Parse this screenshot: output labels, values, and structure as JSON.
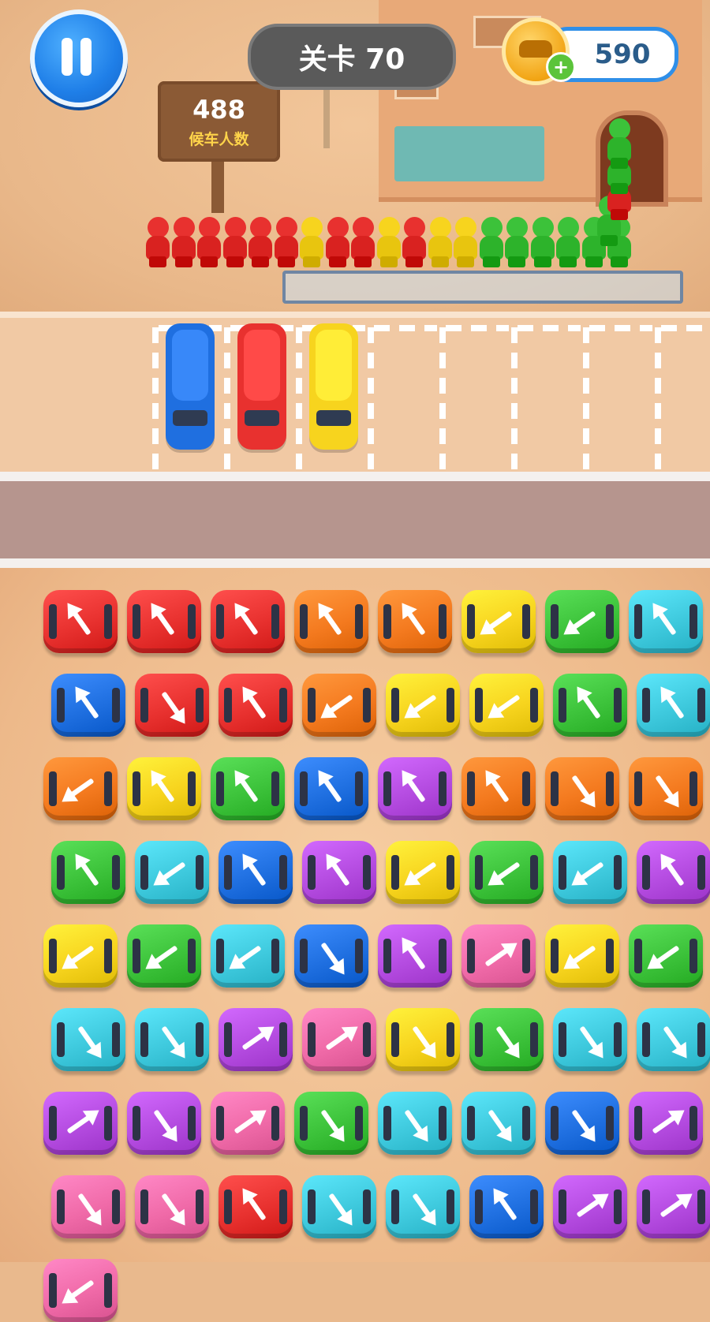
{
  "hud": {
    "level_label": "关卡 70",
    "coins": "590",
    "plus_label": "+",
    "pause_icon": "pause-icon",
    "coin_icon": "car-coin-icon"
  },
  "waiting_sign": {
    "count": "488",
    "label": "候车人数"
  },
  "queue": {
    "order": [
      "red",
      "red",
      "red",
      "red",
      "red",
      "red",
      "yellow",
      "red",
      "red",
      "yellow",
      "red",
      "yellow",
      "yellow",
      "green",
      "green",
      "green",
      "green",
      "green",
      "green",
      "green",
      "red",
      "green",
      "green"
    ]
  },
  "colors": {
    "red": "#e8312f",
    "orange": "#f47a1f",
    "yellow": "#f7d41e",
    "green": "#3cc23a",
    "cyan": "#3ec9dd",
    "blue": "#1f6fe0",
    "purple": "#b44be0",
    "pink": "#f06aa8"
  },
  "parked_cars": [
    {
      "color": "blue",
      "passengers": "blue"
    },
    {
      "color": "red",
      "passengers": "red"
    },
    {
      "color": "yellow",
      "passengers": "yellow"
    }
  ],
  "parking_spots": 8,
  "puzzle_cars": [
    {
      "color": "red",
      "dir": "up"
    },
    {
      "color": "red",
      "dir": "up"
    },
    {
      "color": "red",
      "dir": "up"
    },
    {
      "color": "orange",
      "dir": "up"
    },
    {
      "color": "orange",
      "dir": "up"
    },
    {
      "color": "yellow",
      "dir": "left"
    },
    {
      "color": "green",
      "dir": "left"
    },
    {
      "color": "cyan",
      "dir": "up"
    },
    {
      "color": "blue",
      "dir": "up"
    },
    {
      "color": "red",
      "dir": "down"
    },
    {
      "color": "red",
      "dir": "up"
    },
    {
      "color": "orange",
      "dir": "left"
    },
    {
      "color": "yellow",
      "dir": "left"
    },
    {
      "color": "yellow",
      "dir": "left"
    },
    {
      "color": "green",
      "dir": "up"
    },
    {
      "color": "cyan",
      "dir": "up"
    },
    {
      "color": "orange",
      "dir": "left"
    },
    {
      "color": "yellow",
      "dir": "up"
    },
    {
      "color": "green",
      "dir": "up"
    },
    {
      "color": "blue",
      "dir": "up"
    },
    {
      "color": "purple",
      "dir": "up"
    },
    {
      "color": "orange",
      "dir": "up"
    },
    {
      "color": "orange",
      "dir": "down"
    },
    {
      "color": "orange",
      "dir": "down"
    },
    {
      "color": "green",
      "dir": "up"
    },
    {
      "color": "cyan",
      "dir": "left"
    },
    {
      "color": "blue",
      "dir": "up"
    },
    {
      "color": "purple",
      "dir": "up"
    },
    {
      "color": "yellow",
      "dir": "left"
    },
    {
      "color": "green",
      "dir": "left"
    },
    {
      "color": "cyan",
      "dir": "left"
    },
    {
      "color": "purple",
      "dir": "up"
    },
    {
      "color": "yellow",
      "dir": "left"
    },
    {
      "color": "green",
      "dir": "left"
    },
    {
      "color": "cyan",
      "dir": "left"
    },
    {
      "color": "blue",
      "dir": "down"
    },
    {
      "color": "purple",
      "dir": "up"
    },
    {
      "color": "pink",
      "dir": "right"
    },
    {
      "color": "yellow",
      "dir": "left"
    },
    {
      "color": "green",
      "dir": "left"
    },
    {
      "color": "cyan",
      "dir": "down"
    },
    {
      "color": "cyan",
      "dir": "down"
    },
    {
      "color": "purple",
      "dir": "right"
    },
    {
      "color": "pink",
      "dir": "right"
    },
    {
      "color": "yellow",
      "dir": "down"
    },
    {
      "color": "green",
      "dir": "down"
    },
    {
      "color": "cyan",
      "dir": "down"
    },
    {
      "color": "cyan",
      "dir": "down"
    },
    {
      "color": "purple",
      "dir": "right"
    },
    {
      "color": "purple",
      "dir": "down"
    },
    {
      "color": "pink",
      "dir": "right"
    },
    {
      "color": "green",
      "dir": "down"
    },
    {
      "color": "cyan",
      "dir": "down"
    },
    {
      "color": "cyan",
      "dir": "down"
    },
    {
      "color": "blue",
      "dir": "down"
    },
    {
      "color": "purple",
      "dir": "right"
    },
    {
      "color": "pink",
      "dir": "down"
    },
    {
      "color": "pink",
      "dir": "down"
    },
    {
      "color": "red",
      "dir": "up"
    },
    {
      "color": "cyan",
      "dir": "down"
    },
    {
      "color": "cyan",
      "dir": "down"
    },
    {
      "color": "blue",
      "dir": "up"
    },
    {
      "color": "purple",
      "dir": "right"
    },
    {
      "color": "purple",
      "dir": "right"
    },
    {
      "color": "pink",
      "dir": "left"
    }
  ]
}
